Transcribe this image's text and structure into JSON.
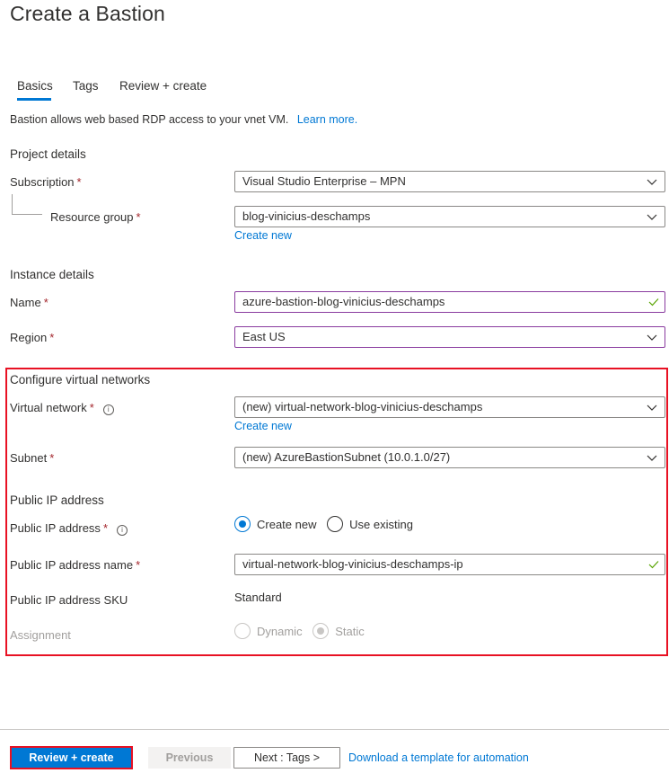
{
  "page": {
    "title": "Create a Bastion",
    "tabs": [
      {
        "label": "Basics",
        "active": true
      },
      {
        "label": "Tags",
        "active": false
      },
      {
        "label": "Review + create",
        "active": false
      }
    ],
    "description": "Bastion allows web based RDP access to your vnet VM.",
    "learn_more": "Learn more."
  },
  "project": {
    "heading": "Project details",
    "subscription": {
      "label": "Subscription",
      "required": "*",
      "value": "Visual Studio Enterprise – MPN"
    },
    "resource_group": {
      "label": "Resource group",
      "required": "*",
      "value": "blog-vinicius-deschamps",
      "create_new": "Create new"
    }
  },
  "instance": {
    "heading": "Instance details",
    "name": {
      "label": "Name",
      "required": "*",
      "value": "azure-bastion-blog-vinicius-deschamps",
      "valid": true
    },
    "region": {
      "label": "Region",
      "required": "*",
      "value": "East US"
    }
  },
  "vnet": {
    "heading": "Configure virtual networks",
    "virtual_network": {
      "label": "Virtual network",
      "required": "*",
      "info_icon": "info-icon",
      "value": "(new) virtual-network-blog-vinicius-deschamps",
      "create_new": "Create new"
    },
    "subnet": {
      "label": "Subnet",
      "required": "*",
      "value": "(new) AzureBastionSubnet (10.0.1.0/27)"
    }
  },
  "public_ip": {
    "heading": "Public IP address",
    "address": {
      "label": "Public IP address",
      "required": "*",
      "info_icon": "info-icon",
      "options": [
        {
          "label": "Create new",
          "selected": true
        },
        {
          "label": "Use existing",
          "selected": false
        }
      ]
    },
    "name": {
      "label": "Public IP address name",
      "required": "*",
      "value": "virtual-network-blog-vinicius-deschamps-ip",
      "valid": true
    },
    "sku": {
      "label": "Public IP address SKU",
      "value": "Standard"
    },
    "assignment": {
      "label": "Assignment",
      "disabled": true,
      "options": [
        {
          "label": "Dynamic",
          "selected": false
        },
        {
          "label": "Static",
          "selected": true
        }
      ]
    }
  },
  "footer": {
    "review_create": "Review + create",
    "previous": "Previous",
    "next": "Next : Tags >",
    "download": "Download a template for automation"
  },
  "colors": {
    "accent": "#0078d4",
    "highlight": "#e81123",
    "required": "#a4262c",
    "valid": "#57a300",
    "focus_border": "#8a3b9f"
  }
}
